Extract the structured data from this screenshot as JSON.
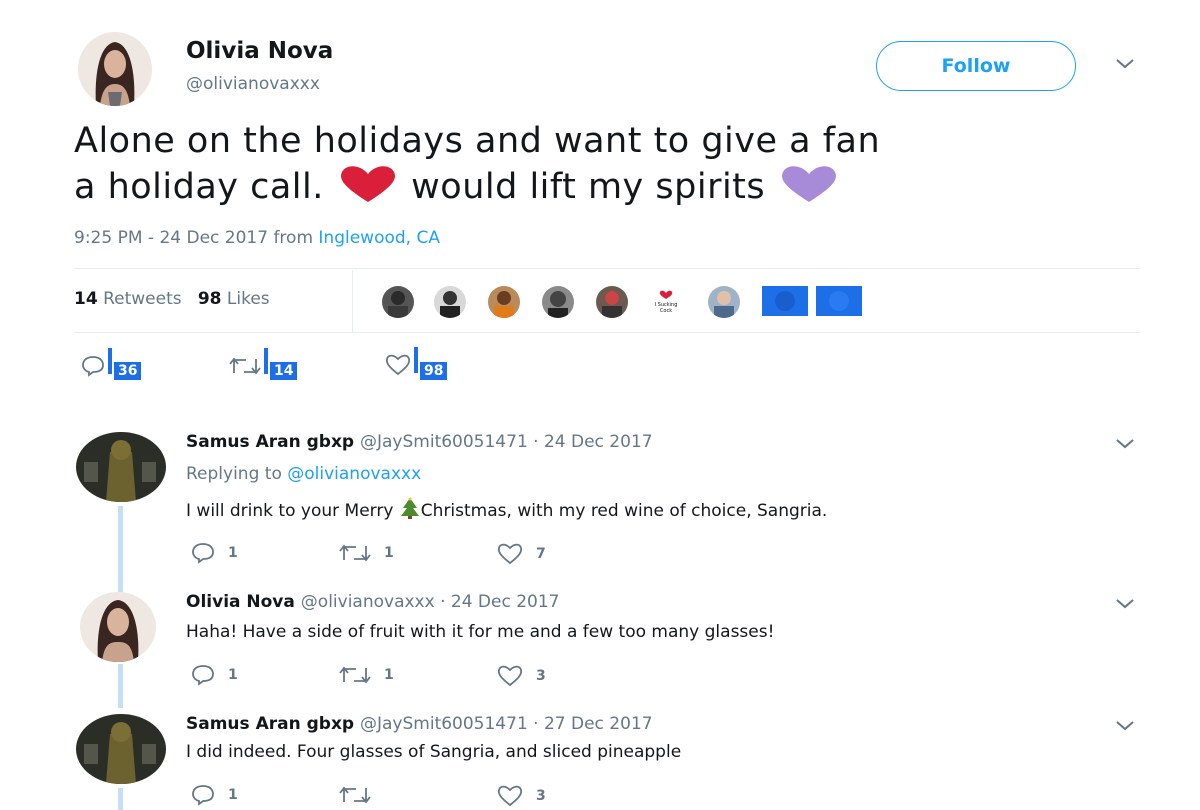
{
  "tweet": {
    "author_name": "Olivia Nova",
    "author_handle": "@olivianovaxxx",
    "follow_label": "Follow",
    "text_line1": "Alone on the holidays and want to give a fan",
    "text_line2_a": "a holiday call.",
    "text_line2_b": "would lift my spirits",
    "time": "9:25 PM - 24 Dec 2017 from",
    "location": "Inglewood, CA",
    "retweets_count": "14",
    "retweets_label": "Retweets",
    "likes_count": "98",
    "likes_label": "Likes",
    "actions": {
      "replies": "36",
      "retweets": "14",
      "likes": "98"
    }
  },
  "replies": [
    {
      "name": "Samus Aran gbxp",
      "meta": "@JaySmit60051471 · 24 Dec 2017",
      "replying_label": "Replying to",
      "replying_to": "@olivianovaxxx",
      "text_a": "I will drink to your Merry",
      "text_b": "Christmas, with my red wine of choice, Sangria.",
      "reply_count": "1",
      "retweet_count": "1",
      "like_count": "7"
    },
    {
      "name": "Olivia Nova",
      "meta": "@olivianovaxxx · 24 Dec 2017",
      "text": "Haha! Have a side of fruit with it for me and a few too many glasses!",
      "reply_count": "1",
      "retweet_count": "1",
      "like_count": "3"
    },
    {
      "name": "Samus Aran gbxp",
      "meta": "@JaySmit60051471 · 27 Dec 2017",
      "text": "I did indeed. Four glasses of Sangria, and sliced pineapple",
      "reply_count": "1",
      "retweet_count": "",
      "like_count": "3"
    }
  ],
  "liker_sticker_text": "I Sucking Cock",
  "colors": {
    "accent": "#1da1f2",
    "highlight": "#1d6fe8",
    "heart_red": "#e0245e",
    "heart_purple": "#a78bd8"
  }
}
